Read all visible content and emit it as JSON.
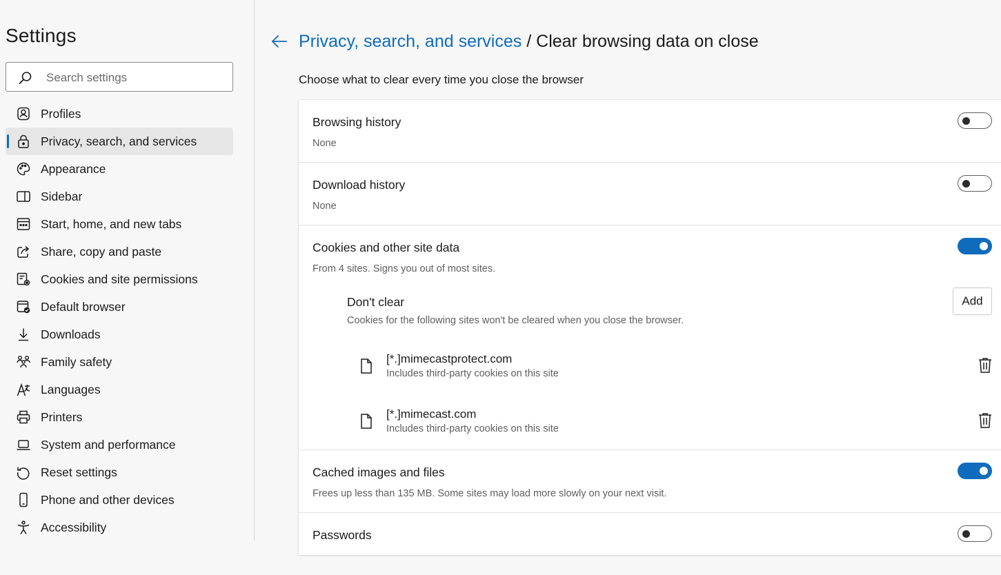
{
  "sidebar": {
    "title": "Settings",
    "search_placeholder": "Search settings",
    "items": [
      {
        "label": "Profiles",
        "icon": "profile-icon"
      },
      {
        "label": "Privacy, search, and services",
        "icon": "lock-icon",
        "active": true
      },
      {
        "label": "Appearance",
        "icon": "palette-icon"
      },
      {
        "label": "Sidebar",
        "icon": "sidebar-icon"
      },
      {
        "label": "Start, home, and new tabs",
        "icon": "home-tabs-icon"
      },
      {
        "label": "Share, copy and paste",
        "icon": "share-icon"
      },
      {
        "label": "Cookies and site permissions",
        "icon": "site-permissions-icon"
      },
      {
        "label": "Default browser",
        "icon": "default-browser-icon"
      },
      {
        "label": "Downloads",
        "icon": "download-icon"
      },
      {
        "label": "Family safety",
        "icon": "family-icon"
      },
      {
        "label": "Languages",
        "icon": "languages-icon"
      },
      {
        "label": "Printers",
        "icon": "printer-icon"
      },
      {
        "label": "System and performance",
        "icon": "laptop-icon"
      },
      {
        "label": "Reset settings",
        "icon": "reset-icon"
      },
      {
        "label": "Phone and other devices",
        "icon": "phone-icon"
      },
      {
        "label": "Accessibility",
        "icon": "accessibility-icon"
      }
    ]
  },
  "header": {
    "breadcrumb_parent": "Privacy, search, and services",
    "separator": "/",
    "breadcrumb_current": "Clear browsing data on close"
  },
  "intro": "Choose what to clear every time you close the browser",
  "settings": [
    {
      "title": "Browsing history",
      "subtitle": "None",
      "enabled": false
    },
    {
      "title": "Download history",
      "subtitle": "None",
      "enabled": false
    },
    {
      "title": "Cookies and other site data",
      "subtitle": "From 4 sites. Signs you out of most sites.",
      "enabled": true
    },
    {
      "title": "Cached images and files",
      "subtitle": "Frees up less than 135 MB. Some sites may load more slowly on your next visit.",
      "enabled": true
    },
    {
      "title": "Passwords",
      "subtitle": "",
      "enabled": false
    }
  ],
  "dont_clear": {
    "title": "Don't clear",
    "subtitle": "Cookies for the following sites won't be cleared when you close the browser.",
    "add_label": "Add",
    "sites": [
      {
        "name": "[*.]mimecastprotect.com",
        "detail": "Includes third-party cookies on this site"
      },
      {
        "name": "[*.]mimecast.com",
        "detail": "Includes third-party cookies on this site"
      }
    ]
  },
  "colors": {
    "accent": "#0f6cbd",
    "toggle_on": "#0f6cbd"
  }
}
